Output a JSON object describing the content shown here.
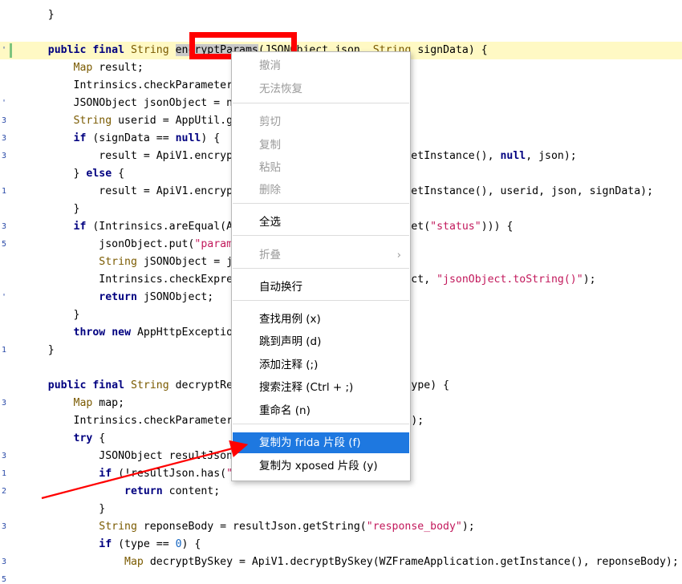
{
  "code_lines": [
    {
      "segments": [
        {
          "t": "    }",
          "c": "punc"
        }
      ]
    },
    {
      "segments": []
    },
    {
      "highlight": true,
      "segments": [
        {
          "t": "    ",
          "c": "punc"
        },
        {
          "t": "public",
          "c": "kw"
        },
        {
          "t": " ",
          "c": "punc"
        },
        {
          "t": "final",
          "c": "kw"
        },
        {
          "t": " ",
          "c": "punc"
        },
        {
          "t": "String",
          "c": "ty"
        },
        {
          "t": " ",
          "c": "punc"
        },
        {
          "t": "encryptParams",
          "c": "sel"
        },
        {
          "t": "(JSONObject json, ",
          "c": "punc"
        },
        {
          "t": "String",
          "c": "ty"
        },
        {
          "t": " signData) {",
          "c": "punc"
        }
      ]
    },
    {
      "segments": [
        {
          "t": "        ",
          "c": "punc"
        },
        {
          "t": "Map",
          "c": "ty"
        },
        {
          "t": " result;",
          "c": "punc"
        }
      ]
    },
    {
      "segments": [
        {
          "t": "        Intrinsics.checkParameterIsNotNull(json, \"json\");",
          "c": "punc"
        }
      ]
    },
    {
      "segments": [
        {
          "t": "        JSONObject jsonObject = new JSONObject();",
          "c": "punc"
        }
      ]
    },
    {
      "segments": [
        {
          "t": "        ",
          "c": "punc"
        },
        {
          "t": "String",
          "c": "ty"
        },
        {
          "t": " userid = AppUtil.getUserId();",
          "c": "punc"
        }
      ]
    },
    {
      "segments": [
        {
          "t": "        ",
          "c": "punc"
        },
        {
          "t": "if",
          "c": "kw"
        },
        {
          "t": " (signData == ",
          "c": "punc"
        },
        {
          "t": "null",
          "c": "kw"
        },
        {
          "t": ") {",
          "c": "punc"
        }
      ]
    },
    {
      "segments": [
        {
          "t": "            result = ApiV1.encryptParams(WZFrameApplication.getInstance(), ",
          "c": "punc"
        },
        {
          "t": "null",
          "c": "kw"
        },
        {
          "t": ", json);",
          "c": "punc"
        }
      ]
    },
    {
      "segments": [
        {
          "t": "        } ",
          "c": "punc"
        },
        {
          "t": "else",
          "c": "kw"
        },
        {
          "t": " {",
          "c": "punc"
        }
      ]
    },
    {
      "segments": [
        {
          "t": "            result = ApiV1.encryptParams(WZFrameApplication.getInstance(), userid, json, signData);",
          "c": "punc"
        }
      ]
    },
    {
      "segments": [
        {
          "t": "        }",
          "c": "punc"
        }
      ]
    },
    {
      "segments": [
        {
          "t": "        ",
          "c": "punc"
        },
        {
          "t": "if",
          "c": "kw"
        },
        {
          "t": " (Intrinsics.areEqual(ApiV1.STATUS_NOTIFY, result.get(",
          "c": "punc"
        },
        {
          "t": "\"status\"",
          "c": "str"
        },
        {
          "t": "))) {",
          "c": "punc"
        }
      ]
    },
    {
      "segments": [
        {
          "t": "            jsonObject.put(",
          "c": "punc"
        },
        {
          "t": "\"params\"",
          "c": "str"
        },
        {
          "t": ", result.get(",
          "c": "punc"
        },
        {
          "t": "\"data\"",
          "c": "str"
        },
        {
          "t": "));",
          "c": "punc"
        }
      ]
    },
    {
      "segments": [
        {
          "t": "            ",
          "c": "punc"
        },
        {
          "t": "String",
          "c": "ty"
        },
        {
          "t": " jSONObject = jsonObject.toString();",
          "c": "punc"
        }
      ]
    },
    {
      "segments": [
        {
          "t": "            Intrinsics.checkExpressionValueIsNotNull(jSONObject, ",
          "c": "punc"
        },
        {
          "t": "\"jsonObject.toString()\"",
          "c": "str"
        },
        {
          "t": ");",
          "c": "punc"
        }
      ]
    },
    {
      "segments": [
        {
          "t": "            ",
          "c": "punc"
        },
        {
          "t": "return",
          "c": "kw"
        },
        {
          "t": " jSONObject;",
          "c": "punc"
        }
      ]
    },
    {
      "segments": [
        {
          "t": "        }",
          "c": "punc"
        }
      ]
    },
    {
      "segments": [
        {
          "t": "        ",
          "c": "punc"
        },
        {
          "t": "throw",
          "c": "kw"
        },
        {
          "t": " ",
          "c": "punc"
        },
        {
          "t": "new",
          "c": "kw"
        },
        {
          "t": " AppHttpException();",
          "c": "punc"
        }
      ]
    },
    {
      "segments": [
        {
          "t": "    }",
          "c": "punc"
        }
      ]
    },
    {
      "segments": []
    },
    {
      "segments": [
        {
          "t": "    ",
          "c": "punc"
        },
        {
          "t": "public",
          "c": "kw"
        },
        {
          "t": " ",
          "c": "punc"
        },
        {
          "t": "final",
          "c": "kw"
        },
        {
          "t": " ",
          "c": "punc"
        },
        {
          "t": "String",
          "c": "ty"
        },
        {
          "t": " decryptResponse(",
          "c": "punc"
        },
        {
          "t": "String",
          "c": "ty"
        },
        {
          "t": " content, ",
          "c": "punc"
        },
        {
          "t": "int",
          "c": "kw"
        },
        {
          "t": " type) {",
          "c": "punc"
        }
      ]
    },
    {
      "segments": [
        {
          "t": "        ",
          "c": "punc"
        },
        {
          "t": "Map",
          "c": "ty"
        },
        {
          "t": " map;",
          "c": "punc"
        }
      ]
    },
    {
      "segments": [
        {
          "t": "        Intrinsics.checkParameterIsNotNull(content, ",
          "c": "punc"
        },
        {
          "t": "\"content\"",
          "c": "str"
        },
        {
          "t": ");",
          "c": "punc"
        }
      ]
    },
    {
      "segments": [
        {
          "t": "        ",
          "c": "punc"
        },
        {
          "t": "try",
          "c": "kw"
        },
        {
          "t": " {",
          "c": "punc"
        }
      ]
    },
    {
      "segments": [
        {
          "t": "            JSONObject resultJson = new JSONObject(content);",
          "c": "punc"
        }
      ]
    },
    {
      "segments": [
        {
          "t": "            ",
          "c": "punc"
        },
        {
          "t": "if",
          "c": "kw"
        },
        {
          "t": " (!resultJson.has(",
          "c": "punc"
        },
        {
          "t": "\"response_body\"",
          "c": "str"
        },
        {
          "t": ")) {",
          "c": "punc"
        }
      ]
    },
    {
      "segments": [
        {
          "t": "                ",
          "c": "punc"
        },
        {
          "t": "return",
          "c": "kw"
        },
        {
          "t": " content;",
          "c": "punc"
        }
      ]
    },
    {
      "segments": [
        {
          "t": "            }",
          "c": "punc"
        }
      ]
    },
    {
      "segments": [
        {
          "t": "            ",
          "c": "punc"
        },
        {
          "t": "String",
          "c": "ty"
        },
        {
          "t": " reponseBody = resultJson.getString(",
          "c": "punc"
        },
        {
          "t": "\"response_body\"",
          "c": "str"
        },
        {
          "t": ");",
          "c": "punc"
        }
      ]
    },
    {
      "segments": [
        {
          "t": "            ",
          "c": "punc"
        },
        {
          "t": "if",
          "c": "kw"
        },
        {
          "t": " (type == ",
          "c": "punc"
        },
        {
          "t": "0",
          "c": "num"
        },
        {
          "t": ") {",
          "c": "punc"
        }
      ]
    },
    {
      "segments": [
        {
          "t": "                ",
          "c": "punc"
        },
        {
          "t": "Map",
          "c": "ty"
        },
        {
          "t": " decryptBySkey = ApiV1.decryptBySkey(WZFrameApplication.getInstance(), reponseBody);",
          "c": "punc"
        }
      ]
    }
  ],
  "gutter_marks": [
    "'",
    "'",
    "3",
    "3",
    "3",
    "1",
    "3",
    "5",
    "'",
    "1",
    "3",
    "3",
    "1",
    "2",
    "3",
    "3",
    "5"
  ],
  "context_menu": {
    "items": [
      {
        "label": "撤消",
        "disabled": true
      },
      {
        "label": "无法恢复",
        "disabled": true
      },
      {
        "label": "剪切",
        "disabled": true
      },
      {
        "label": "复制",
        "disabled": true
      },
      {
        "label": "粘贴",
        "disabled": true
      },
      {
        "label": "删除",
        "disabled": true
      },
      {
        "label": "全选",
        "disabled": false
      },
      {
        "label": "折叠",
        "disabled": true,
        "submenu": true
      },
      {
        "label": "自动换行",
        "disabled": false
      },
      {
        "label": "查找用例 (x)",
        "disabled": false
      },
      {
        "label": "跳到声明 (d)",
        "disabled": false
      },
      {
        "label": "添加注释 (;)",
        "disabled": false
      },
      {
        "label": "搜索注释 (Ctrl + ;)",
        "disabled": false
      },
      {
        "label": "重命名 (n)",
        "disabled": false
      },
      {
        "label": "复制为 frida 片段 (f)",
        "disabled": false,
        "selected": true
      },
      {
        "label": "复制为 xposed 片段 (y)",
        "disabled": false
      }
    ],
    "submenu_chevron": "›"
  },
  "colors": {
    "highlight_line": "#fff9c4",
    "menu_selected": "#1e78e0",
    "annotation_red": "#ff0000",
    "change_bar": "#7ec47e"
  },
  "icons": [
    "chevron-right-icon"
  ]
}
